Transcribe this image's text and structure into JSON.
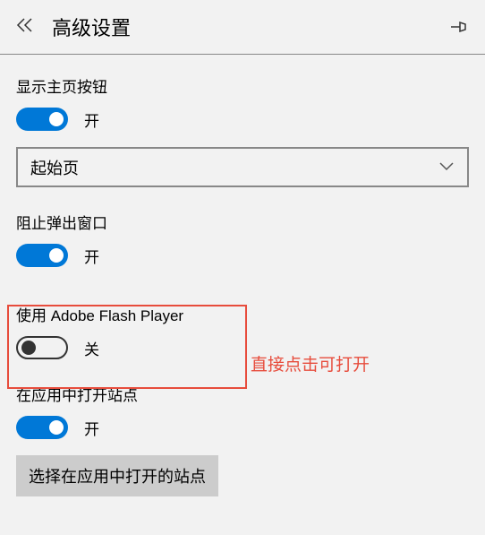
{
  "header": {
    "title": "高级设置"
  },
  "settings": {
    "home_button": {
      "label": "显示主页按钮",
      "state_text": "开"
    },
    "dropdown": {
      "selected": "起始页"
    },
    "popup_block": {
      "label": "阻止弹出窗口",
      "state_text": "开"
    },
    "flash": {
      "label": "使用 Adobe Flash Player",
      "state_text": "关"
    },
    "open_in_app": {
      "label": "在应用中打开站点",
      "state_text": "开"
    },
    "choose_sites_button": "选择在应用中打开的站点"
  },
  "annotation": {
    "text": "直接点击可打开"
  }
}
